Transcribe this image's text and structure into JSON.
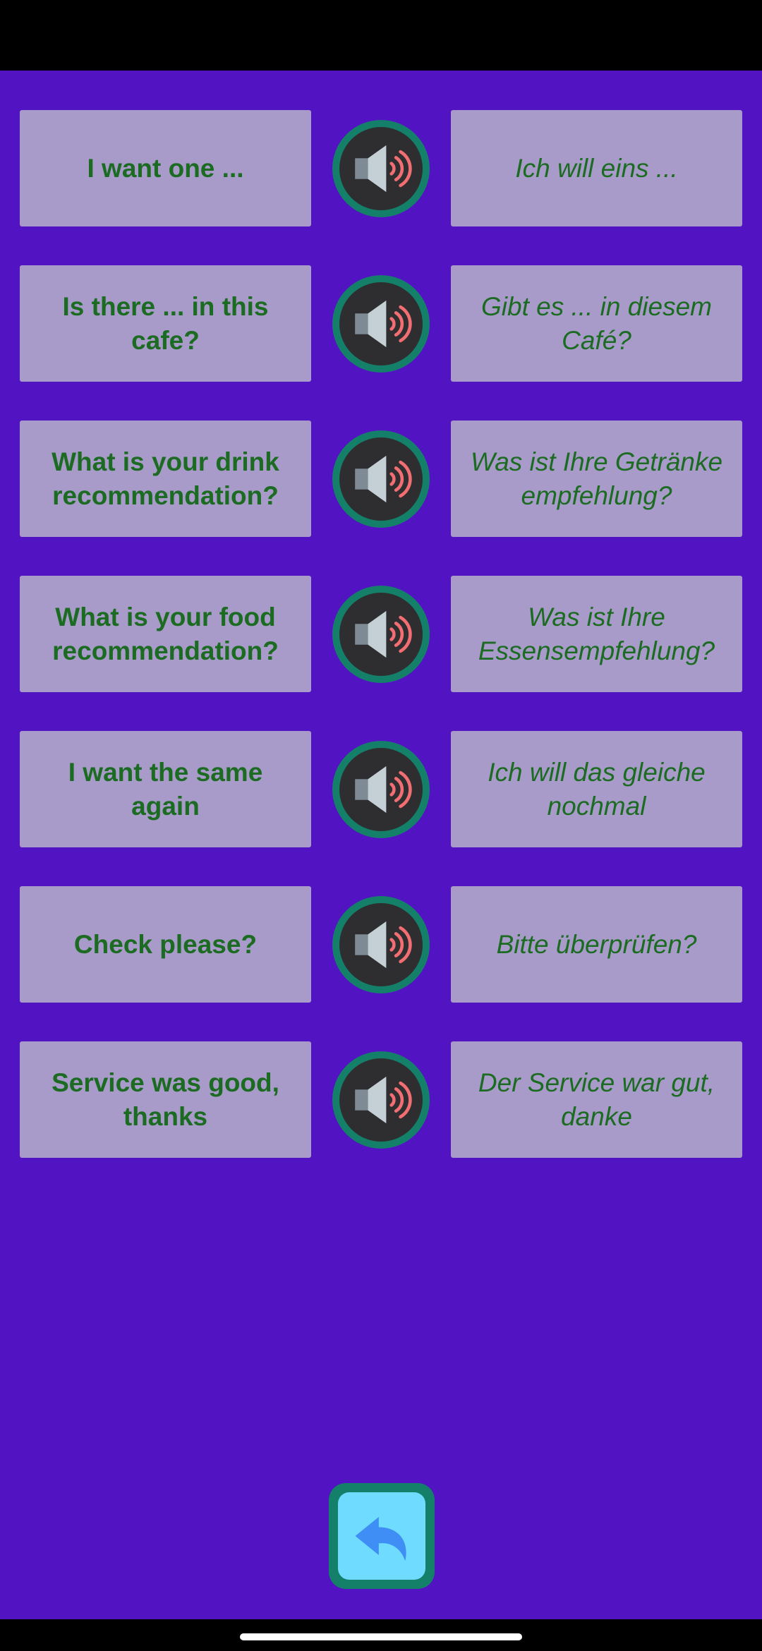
{
  "phrases": [
    {
      "english": "I want one ...",
      "german": "Ich will eins ..."
    },
    {
      "english": "Is there ... in this cafe?",
      "german": "Gibt es ... in diesem Café?"
    },
    {
      "english": "What is your drink recommendation?",
      "german": "Was ist Ihre Getränke empfehlung?"
    },
    {
      "english": "What is your food recommendation?",
      "german": "Was ist Ihre Essensempfehlung?"
    },
    {
      "english": "I want the same again",
      "german": "Ich will das gleiche nochmal"
    },
    {
      "english": "Check please?",
      "german": "Bitte überprüfen?"
    },
    {
      "english": "Service was good, thanks",
      "german": "Der Service war gut, danke"
    }
  ],
  "icons": {
    "speaker": "speaker-icon",
    "back": "back-arrow-icon"
  },
  "colors": {
    "background": "#5213C2",
    "card": "#A99BC9",
    "text": "#1C6B22",
    "button_ring": "#14806A",
    "back_fill": "#6EDBFF"
  }
}
